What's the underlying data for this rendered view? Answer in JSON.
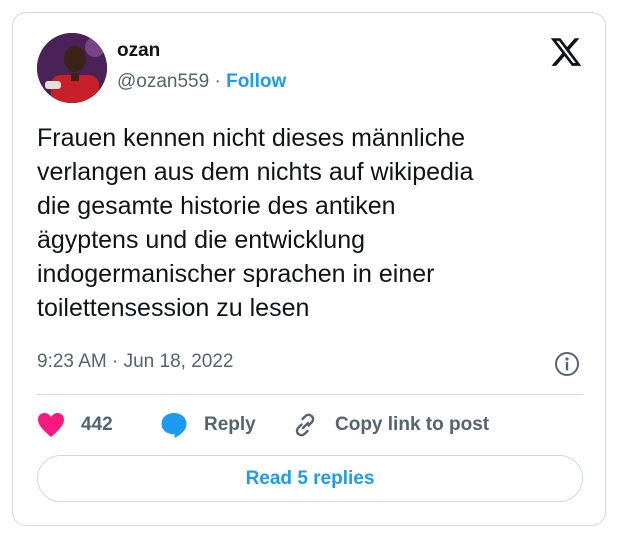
{
  "author": {
    "name": "ozan",
    "handle": "@ozan559",
    "separator": "·",
    "follow_label": "Follow"
  },
  "tweet": {
    "text": "Frauen kennen nicht dieses männliche\nverlangen aus dem nichts auf wikipedia\ndie gesamte historie des antiken\nägyptens und die entwicklung\nindogermanischer sprachen in einer\ntoilettensession zu lesen",
    "time": "9:23 AM",
    "separator": "·",
    "date": "Jun 18, 2022"
  },
  "actions": {
    "likes": "442",
    "reply_label": "Reply",
    "copy_label": "Copy link to post"
  },
  "read_replies_label": "Read 5 replies",
  "icons": {
    "logo": "x-logo-icon",
    "info": "info-icon",
    "like": "heart-icon",
    "reply": "speech-bubble-icon",
    "copy": "link-icon"
  },
  "colors": {
    "accent": "#1d9bf0",
    "like": "#f91880",
    "text": "#0f1419",
    "muted": "#536471",
    "border": "#cfd9de"
  }
}
